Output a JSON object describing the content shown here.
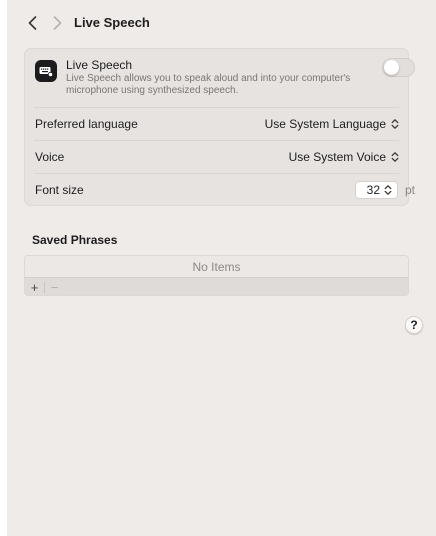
{
  "toolbar": {
    "title": "Live Speech",
    "back_icon": "chevron-left-icon",
    "forward_icon": "chevron-right-icon"
  },
  "live_speech": {
    "title": "Live Speech",
    "description": "Live Speech allows you to speak aloud and into your computer's microphone using synthesized speech.",
    "icon": "keyboard-speech-icon",
    "enabled": false
  },
  "settings": {
    "preferred_language": {
      "label": "Preferred language",
      "value": "Use System Language"
    },
    "voice": {
      "label": "Voice",
      "value": "Use System Voice"
    },
    "font_size": {
      "label": "Font size",
      "value": "32",
      "unit": "pt"
    }
  },
  "saved_phrases": {
    "title": "Saved Phrases",
    "empty_text": "No Items",
    "add_label": "+",
    "remove_label": "−"
  },
  "help": {
    "label": "?"
  }
}
